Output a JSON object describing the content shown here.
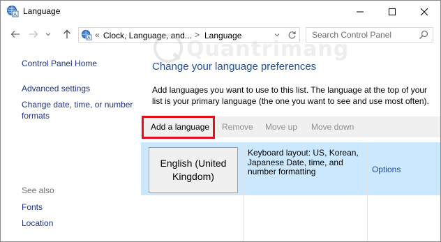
{
  "window": {
    "title": "Language",
    "controls": {
      "minimize": "minimize-icon",
      "maximize": "maximize-icon",
      "close": "close-icon"
    }
  },
  "nav": {
    "back_icon": "arrow-left-icon",
    "forward_icon": "arrow-right-icon",
    "recent_icon": "chevron-down-icon",
    "up_icon": "arrow-up-icon"
  },
  "address": {
    "overflow": "«",
    "crumbs": [
      "Clock, Language, and...",
      "Language"
    ],
    "separator": ">",
    "refresh_icon": "refresh-icon"
  },
  "search": {
    "placeholder": "Search Control Panel"
  },
  "sidebar": {
    "links": [
      {
        "label": "Control Panel Home"
      },
      {
        "label": "Advanced settings"
      },
      {
        "label": "Change date, time, or number formats"
      }
    ],
    "see_also": {
      "heading": "See also",
      "links": [
        {
          "label": "Fonts"
        },
        {
          "label": "Location"
        }
      ]
    }
  },
  "main": {
    "title": "Change your language preferences",
    "description": "Add languages you want to use to this list. The language at the top of your list is your primary language (the one you want to see and use most often).",
    "toolbar": {
      "add": "Add a language",
      "remove": "Remove",
      "move_up": "Move up",
      "move_down": "Move down"
    },
    "languages": [
      {
        "name": "English (United Kingdom)",
        "info": "Keyboard layout: US, Korean, Japanese Date, time, and number formatting",
        "options": "Options"
      }
    ]
  },
  "colors": {
    "link": "#1e3287",
    "title": "#1e4e9c",
    "selected_row": "#cce8ff",
    "toolbar": "#f0f0f0",
    "highlight": "#e0101e"
  },
  "watermark": {
    "text": "Quantrimang"
  }
}
